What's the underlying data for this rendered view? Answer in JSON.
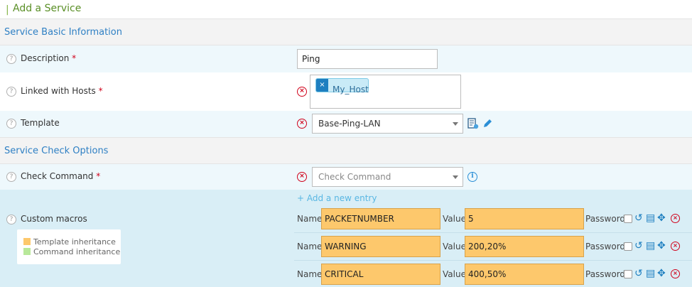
{
  "page": {
    "title": "Add a Service"
  },
  "sections": {
    "basic": "Service Basic Information",
    "check": "Service Check Options"
  },
  "fields": {
    "description": {
      "label": "Description",
      "value": "Ping"
    },
    "hosts": {
      "label": "Linked with Hosts",
      "tags": [
        "My_Host"
      ]
    },
    "template": {
      "label": "Template",
      "value": "Base-Ping-LAN"
    },
    "check_command": {
      "label": "Check Command",
      "placeholder": "Check Command"
    },
    "custom_macros": {
      "label": "Custom macros"
    }
  },
  "required_mark": "*",
  "help_glyph": "?",
  "macros": {
    "add_entry": "+ Add a new entry",
    "name_label": "Name",
    "value_label": "Value",
    "password_label": "Password",
    "rows": [
      {
        "name": "PACKETNUMBER",
        "value": "5"
      },
      {
        "name": "WARNING",
        "value": "200,20%"
      },
      {
        "name": "CRITICAL",
        "value": "400,50%"
      }
    ]
  },
  "legend": {
    "template": {
      "label": "Template inheritance",
      "color": "#fdc86c"
    },
    "command": {
      "label": "Command inheritance",
      "color": "#b8e89a"
    }
  },
  "icons": {
    "help": "question-circle-icon",
    "clear": "clear-circle-icon",
    "info": "info-circle-icon",
    "template_view": "document-view-icon",
    "edit": "pencil-icon",
    "undo": "undo-icon",
    "list": "list-icon",
    "move": "move-icon",
    "remove": "remove-circle-icon"
  }
}
